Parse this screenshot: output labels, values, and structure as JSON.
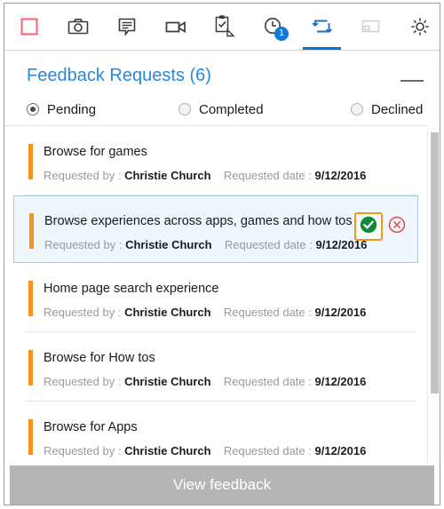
{
  "toolbar": {
    "buttons": [
      {
        "name": "stop-recording-button",
        "icon": "red-square-icon",
        "state": "normal"
      },
      {
        "name": "screenshot-button",
        "icon": "camera-icon",
        "state": "normal"
      },
      {
        "name": "comment-button",
        "icon": "comment-bubble-icon",
        "state": "normal"
      },
      {
        "name": "record-video-button",
        "icon": "video-camera-icon",
        "state": "normal"
      },
      {
        "name": "tasks-button",
        "icon": "clipboard-check-icon",
        "state": "normal"
      },
      {
        "name": "history-button",
        "icon": "clock-icon",
        "state": "normal",
        "badge": "1"
      },
      {
        "name": "feedback-requests-button",
        "icon": "repeat-loop-icon",
        "state": "active"
      },
      {
        "name": "screen-share-button",
        "icon": "monitor-icon",
        "state": "disabled"
      },
      {
        "name": "settings-button",
        "icon": "gear-icon",
        "state": "normal"
      },
      {
        "name": "info-button",
        "icon": "info-circle-icon",
        "state": "normal"
      }
    ],
    "active_index": 6,
    "badge_value": "1",
    "accent_color": "#0078d7",
    "badge_color": "#0f7ad4",
    "stop_color": "#f4646e"
  },
  "panel": {
    "title": "Feedback Requests (6)",
    "title_color": "#2b88d8",
    "minimize_label": "—"
  },
  "filters": {
    "options": [
      {
        "label": "Pending",
        "selected": true
      },
      {
        "label": "Completed",
        "selected": false
      },
      {
        "label": "Declined",
        "selected": false
      }
    ]
  },
  "list": {
    "requested_by_label": "Requested by :",
    "requested_date_label": "Requested date :",
    "accent_color": "#f7941e",
    "items": [
      {
        "title": "Browse for games",
        "requested_by": "Christie Church",
        "requested_date": "9/12/2016",
        "selected": false
      },
      {
        "title": "Browse experiences across apps, games and how tos",
        "requested_by": "Christie Church",
        "requested_date": "9/12/2016",
        "selected": true,
        "accept_label": "Accept request",
        "decline_label": "Decline request"
      },
      {
        "title": "Home page search experience",
        "requested_by": "Christie Church",
        "requested_date": "9/12/2016",
        "selected": false
      },
      {
        "title": "Browse for How tos",
        "requested_by": "Christie Church",
        "requested_date": "9/12/2016",
        "selected": false
      },
      {
        "title": "Browse for Apps",
        "requested_by": "Christie Church",
        "requested_date": "9/12/2016",
        "selected": false
      }
    ]
  },
  "footer": {
    "button_label": "View feedback",
    "button_color": "#b5b5b5"
  }
}
